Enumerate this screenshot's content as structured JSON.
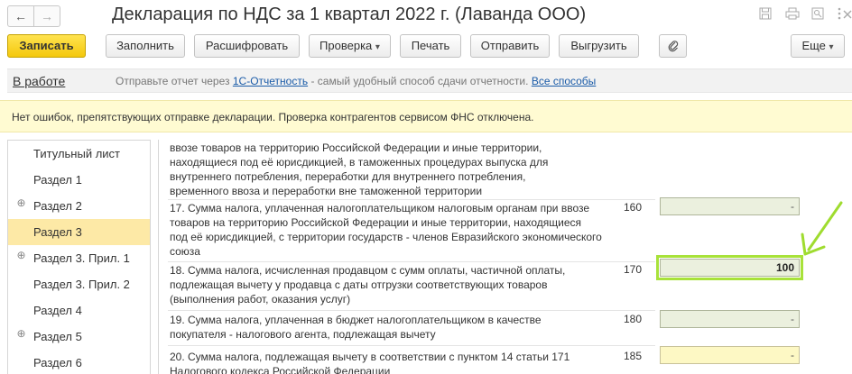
{
  "window": {
    "title": "Декларация по НДС за 1 квартал 2022 г. (Лаванда ООО)",
    "back_glyph": "←",
    "forward_glyph": "→",
    "icons": [
      "save-icon",
      "print-icon",
      "zoom-icon",
      "more-icon",
      "close-icon"
    ]
  },
  "toolbar": {
    "save_label": "Записать",
    "fill_label": "Заполнить",
    "decode_label": "Расшифровать",
    "check_label": "Проверка",
    "print_label": "Печать",
    "send_label": "Отправить",
    "export_label": "Выгрузить",
    "more_label": "Еще",
    "dropdown_glyph": "▾",
    "attach_glyph": "📎"
  },
  "status": {
    "state": "В работе",
    "message_prefix": "Отправьте отчет через",
    "service_link": "1С-Отчетность",
    "message_suffix": "- самый удобный способ сдачи отчетности.",
    "all_methods_link": "Все способы"
  },
  "banner": {
    "text": "Нет ошибок, препятствующих отправке декларации. Проверка контрагентов сервисом ФНС отключена."
  },
  "sidebar": {
    "items": [
      {
        "label": "Титульный лист",
        "expandable": false,
        "active": false
      },
      {
        "label": "Раздел 1",
        "expandable": false,
        "active": false
      },
      {
        "label": "Раздел 2",
        "expandable": true,
        "active": false
      },
      {
        "label": "Раздел 3",
        "expandable": false,
        "active": true
      },
      {
        "label": "Раздел 3. Прил. 1",
        "expandable": true,
        "active": false
      },
      {
        "label": "Раздел 3. Прил. 2",
        "expandable": false,
        "active": false
      },
      {
        "label": "Раздел 4",
        "expandable": false,
        "active": false
      },
      {
        "label": "Раздел 5",
        "expandable": true,
        "active": false
      },
      {
        "label": "Раздел 6",
        "expandable": false,
        "active": false
      }
    ],
    "expand_glyph": "⊕"
  },
  "document": {
    "intro_lines": [
      "ввозе товаров на территорию Российской Федерации и иные территории,",
      "находящиеся под её юрисдикцией, в таможенных процедурах выпуска для",
      "внутреннего потребления, переработки для внутреннего потребления,",
      "временного ввоза и переработки вне таможенной территории"
    ],
    "rows": [
      {
        "lines": [
          "17. Сумма налога, уплаченная налогоплательщиком налоговым органам при ввозе",
          "товаров на территорию Российской Федерации и иные территории, находящиеся",
          "под её юрисдикцией, с территории государств - членов Евразийского экономического",
          "союза"
        ],
        "code": "160",
        "value": "-"
      },
      {
        "lines": [
          "18. Сумма налога, исчисленная продавцом с сумм оплаты, частичной оплаты,",
          "подлежащая вычету у продавца с даты отгрузки соответствующих товаров",
          "(выполнения работ, оказания услуг)"
        ],
        "code": "170",
        "value": "100"
      },
      {
        "lines": [
          "19. Сумма налога, уплаченная в бюджет налогоплательщиком в качестве",
          "покупателя - налогового агента, подлежащая вычету"
        ],
        "code": "180",
        "value": "-"
      },
      {
        "lines": [
          "20. Сумма налога, подлежащая вычету в соответствии с пунктом 14 статьи 171",
          "Налогового кодекса Российской Федерации"
        ],
        "code": "185",
        "value": "-"
      }
    ]
  },
  "colors": {
    "accent_highlight": "#a8e23a",
    "primary_button": "#f4c80d",
    "active_sidebar": "#fde9a6",
    "banner_bg": "#fffbd2"
  }
}
